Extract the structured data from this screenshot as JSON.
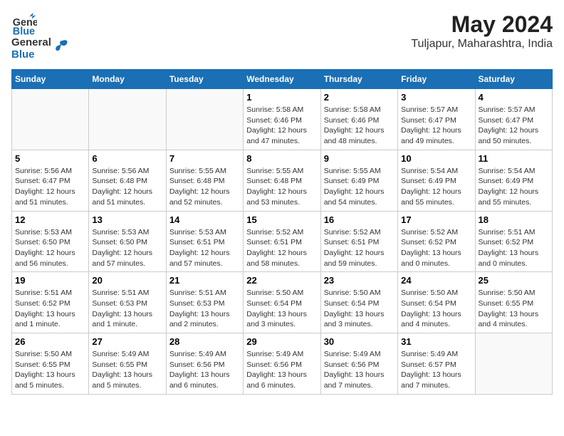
{
  "header": {
    "logo_general": "General",
    "logo_blue": "Blue",
    "month_year": "May 2024",
    "location": "Tuljapur, Maharashtra, India"
  },
  "weekdays": [
    "Sunday",
    "Monday",
    "Tuesday",
    "Wednesday",
    "Thursday",
    "Friday",
    "Saturday"
  ],
  "weeks": [
    [
      {
        "day": "",
        "info": ""
      },
      {
        "day": "",
        "info": ""
      },
      {
        "day": "",
        "info": ""
      },
      {
        "day": "1",
        "info": "Sunrise: 5:58 AM\nSunset: 6:46 PM\nDaylight: 12 hours\nand 47 minutes."
      },
      {
        "day": "2",
        "info": "Sunrise: 5:58 AM\nSunset: 6:46 PM\nDaylight: 12 hours\nand 48 minutes."
      },
      {
        "day": "3",
        "info": "Sunrise: 5:57 AM\nSunset: 6:47 PM\nDaylight: 12 hours\nand 49 minutes."
      },
      {
        "day": "4",
        "info": "Sunrise: 5:57 AM\nSunset: 6:47 PM\nDaylight: 12 hours\nand 50 minutes."
      }
    ],
    [
      {
        "day": "5",
        "info": "Sunrise: 5:56 AM\nSunset: 6:47 PM\nDaylight: 12 hours\nand 51 minutes."
      },
      {
        "day": "6",
        "info": "Sunrise: 5:56 AM\nSunset: 6:48 PM\nDaylight: 12 hours\nand 51 minutes."
      },
      {
        "day": "7",
        "info": "Sunrise: 5:55 AM\nSunset: 6:48 PM\nDaylight: 12 hours\nand 52 minutes."
      },
      {
        "day": "8",
        "info": "Sunrise: 5:55 AM\nSunset: 6:48 PM\nDaylight: 12 hours\nand 53 minutes."
      },
      {
        "day": "9",
        "info": "Sunrise: 5:55 AM\nSunset: 6:49 PM\nDaylight: 12 hours\nand 54 minutes."
      },
      {
        "day": "10",
        "info": "Sunrise: 5:54 AM\nSunset: 6:49 PM\nDaylight: 12 hours\nand 55 minutes."
      },
      {
        "day": "11",
        "info": "Sunrise: 5:54 AM\nSunset: 6:49 PM\nDaylight: 12 hours\nand 55 minutes."
      }
    ],
    [
      {
        "day": "12",
        "info": "Sunrise: 5:53 AM\nSunset: 6:50 PM\nDaylight: 12 hours\nand 56 minutes."
      },
      {
        "day": "13",
        "info": "Sunrise: 5:53 AM\nSunset: 6:50 PM\nDaylight: 12 hours\nand 57 minutes."
      },
      {
        "day": "14",
        "info": "Sunrise: 5:53 AM\nSunset: 6:51 PM\nDaylight: 12 hours\nand 57 minutes."
      },
      {
        "day": "15",
        "info": "Sunrise: 5:52 AM\nSunset: 6:51 PM\nDaylight: 12 hours\nand 58 minutes."
      },
      {
        "day": "16",
        "info": "Sunrise: 5:52 AM\nSunset: 6:51 PM\nDaylight: 12 hours\nand 59 minutes."
      },
      {
        "day": "17",
        "info": "Sunrise: 5:52 AM\nSunset: 6:52 PM\nDaylight: 13 hours\nand 0 minutes."
      },
      {
        "day": "18",
        "info": "Sunrise: 5:51 AM\nSunset: 6:52 PM\nDaylight: 13 hours\nand 0 minutes."
      }
    ],
    [
      {
        "day": "19",
        "info": "Sunrise: 5:51 AM\nSunset: 6:52 PM\nDaylight: 13 hours\nand 1 minute."
      },
      {
        "day": "20",
        "info": "Sunrise: 5:51 AM\nSunset: 6:53 PM\nDaylight: 13 hours\nand 1 minute."
      },
      {
        "day": "21",
        "info": "Sunrise: 5:51 AM\nSunset: 6:53 PM\nDaylight: 13 hours\nand 2 minutes."
      },
      {
        "day": "22",
        "info": "Sunrise: 5:50 AM\nSunset: 6:54 PM\nDaylight: 13 hours\nand 3 minutes."
      },
      {
        "day": "23",
        "info": "Sunrise: 5:50 AM\nSunset: 6:54 PM\nDaylight: 13 hours\nand 3 minutes."
      },
      {
        "day": "24",
        "info": "Sunrise: 5:50 AM\nSunset: 6:54 PM\nDaylight: 13 hours\nand 4 minutes."
      },
      {
        "day": "25",
        "info": "Sunrise: 5:50 AM\nSunset: 6:55 PM\nDaylight: 13 hours\nand 4 minutes."
      }
    ],
    [
      {
        "day": "26",
        "info": "Sunrise: 5:50 AM\nSunset: 6:55 PM\nDaylight: 13 hours\nand 5 minutes."
      },
      {
        "day": "27",
        "info": "Sunrise: 5:49 AM\nSunset: 6:55 PM\nDaylight: 13 hours\nand 5 minutes."
      },
      {
        "day": "28",
        "info": "Sunrise: 5:49 AM\nSunset: 6:56 PM\nDaylight: 13 hours\nand 6 minutes."
      },
      {
        "day": "29",
        "info": "Sunrise: 5:49 AM\nSunset: 6:56 PM\nDaylight: 13 hours\nand 6 minutes."
      },
      {
        "day": "30",
        "info": "Sunrise: 5:49 AM\nSunset: 6:56 PM\nDaylight: 13 hours\nand 7 minutes."
      },
      {
        "day": "31",
        "info": "Sunrise: 5:49 AM\nSunset: 6:57 PM\nDaylight: 13 hours\nand 7 minutes."
      },
      {
        "day": "",
        "info": ""
      }
    ]
  ]
}
